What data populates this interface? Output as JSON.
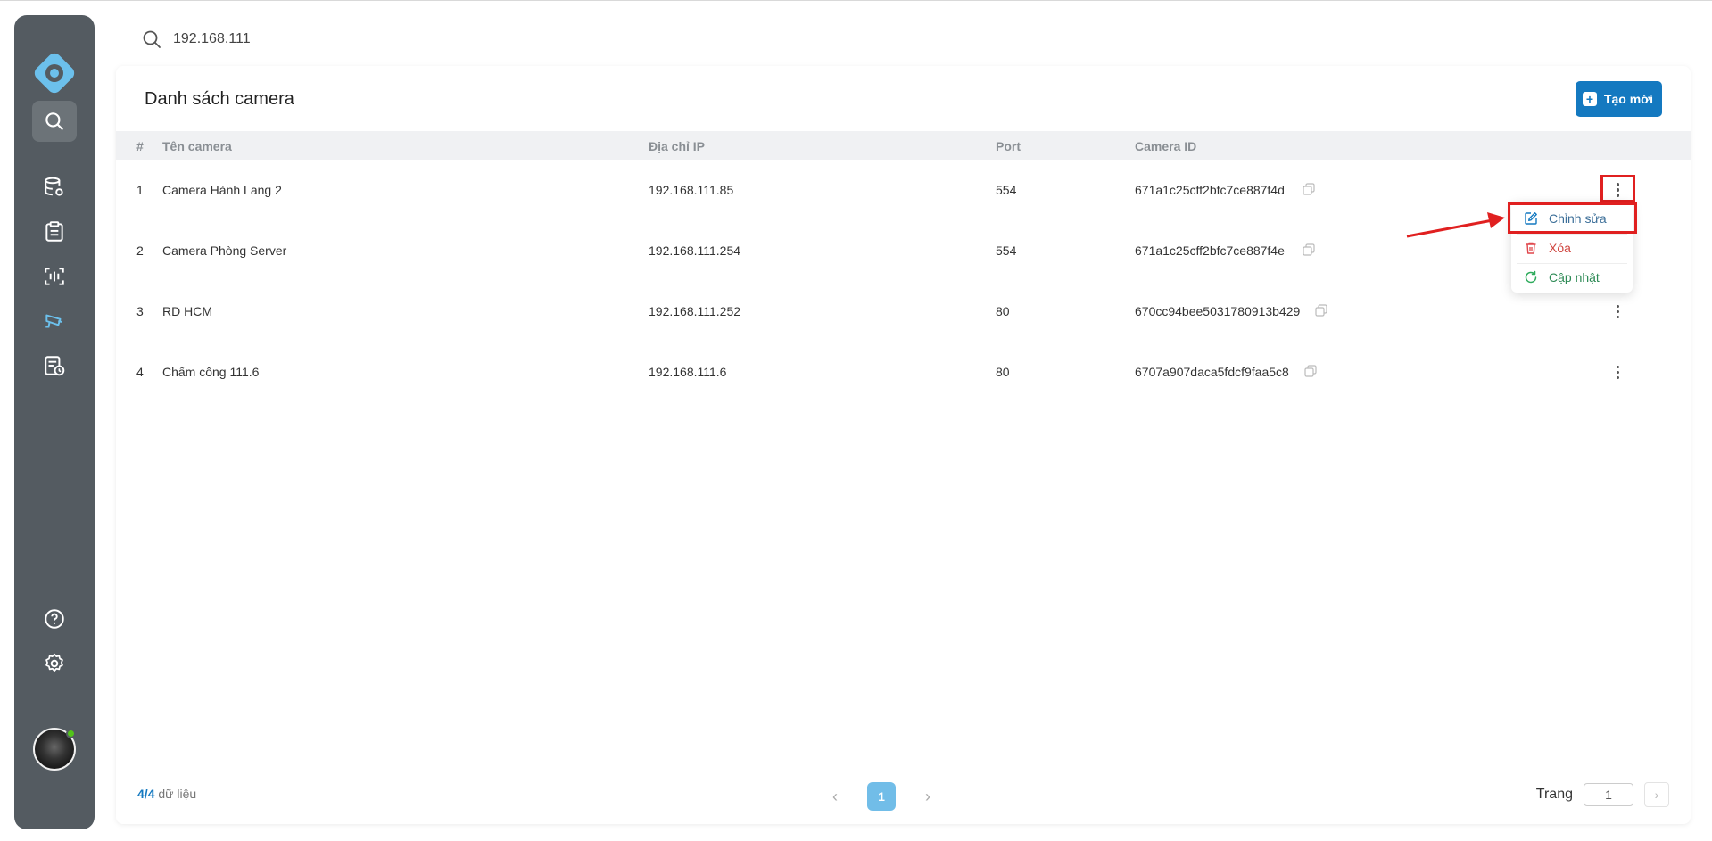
{
  "search": {
    "value": "192.168.111"
  },
  "page": {
    "title": "Danh sách camera",
    "create_label": "Tạo mới"
  },
  "table": {
    "headers": [
      "#",
      "Tên camera",
      "Địa chỉ IP",
      "Port",
      "Camera ID"
    ],
    "rows": [
      {
        "no": "1",
        "name": "Camera Hành Lang 2",
        "ip": "192.168.111.85",
        "port": "554",
        "id": "671a1c25cff2bfc7ce887f4d"
      },
      {
        "no": "2",
        "name": "Camera Phòng Server",
        "ip": "192.168.111.254",
        "port": "554",
        "id": "671a1c25cff2bfc7ce887f4e"
      },
      {
        "no": "3",
        "name": "RD HCM",
        "ip": "192.168.111.252",
        "port": "80",
        "id": "670cc94bee5031780913b429"
      },
      {
        "no": "4",
        "name": "Chấm công 111.6",
        "ip": "192.168.111.6",
        "port": "80",
        "id": "6707a907daca5fdcf9faa5c8"
      }
    ]
  },
  "row_menu": {
    "edit": "Chỉnh sửa",
    "delete": "Xóa",
    "update": "Cập nhật"
  },
  "footer": {
    "count_current": "4",
    "count_sep": "/",
    "count_total": "4",
    "count_suffix": " dữ liệu",
    "current_page": "1",
    "goto_label": "Trang",
    "goto_value": "1"
  },
  "colors": {
    "sidebar": "#545b61",
    "accent": "#1479c0",
    "page_active": "#71bde8",
    "highlight": "#e02020",
    "delete": "#e0474c",
    "update": "#2eab5c"
  }
}
